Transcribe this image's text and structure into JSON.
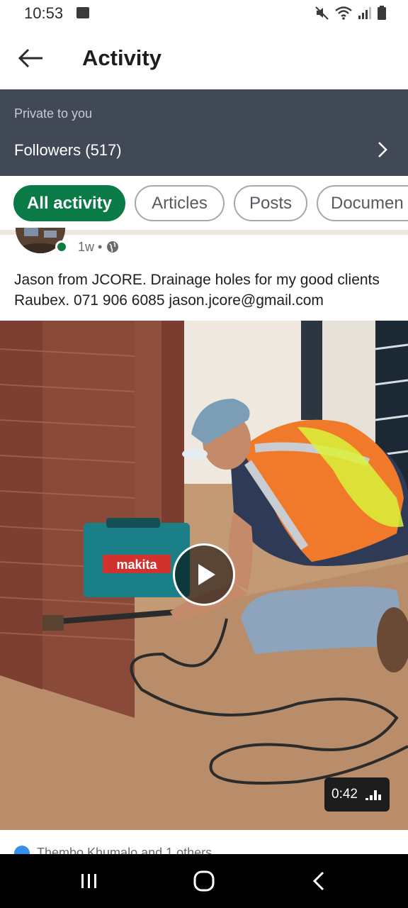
{
  "status_bar": {
    "time": "10:53",
    "icons": [
      "image-icon",
      "mute-icon",
      "wifi-icon",
      "signal-icon",
      "battery-icon"
    ]
  },
  "app_bar": {
    "title": "Activity",
    "back_icon": "arrow-left-icon"
  },
  "private_section": {
    "label": "Private to you",
    "followers_label": "Followers (517)"
  },
  "filters": {
    "chips": [
      "All activity",
      "Articles",
      "Posts",
      "Documen"
    ],
    "selected": "All activity",
    "accent_color": "#0a7a47"
  },
  "post": {
    "time": "1w",
    "separator": "•",
    "text": "Jason from JCORE. Drainage holes for my good clients Raubex. 071 906 6085 jason.jcore@gmail.com",
    "video_duration": "0:42",
    "brand_on_case": "makita",
    "reactions_text": "Thembo Khumalo and 1 others"
  },
  "colors": {
    "banner_bg": "#404955",
    "online_dot": "#107c41"
  }
}
